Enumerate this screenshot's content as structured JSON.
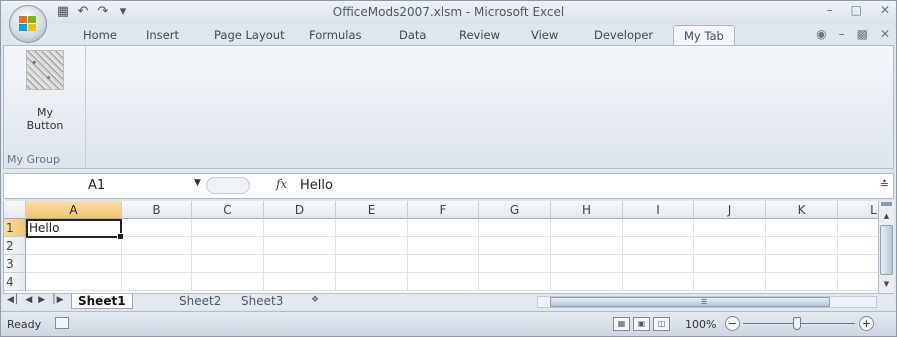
{
  "window": {
    "title": "OfficeMods2007.xlsm - Microsoft Excel",
    "qat_icons": [
      "save-icon",
      "undo-icon",
      "redo-icon",
      "customize-qat-icon"
    ]
  },
  "tabs": [
    {
      "label": "Home"
    },
    {
      "label": "Insert"
    },
    {
      "label": "Page Layout"
    },
    {
      "label": "Formulas"
    },
    {
      "label": "Data"
    },
    {
      "label": "Review"
    },
    {
      "label": "View"
    },
    {
      "label": "Developer"
    },
    {
      "label": "My Tab",
      "active": true
    }
  ],
  "ribbon": {
    "group_label": "My Group",
    "button_line1": "My",
    "button_line2": "Button"
  },
  "formula_bar": {
    "name_box": "A1",
    "fx_label": "fx",
    "value": "Hello"
  },
  "grid": {
    "columns": [
      "A",
      "B",
      "C",
      "D",
      "E",
      "F",
      "G",
      "H",
      "I",
      "J",
      "K",
      "L"
    ],
    "rows": [
      "1",
      "2",
      "3",
      "4"
    ],
    "cells": {
      "A1": "Hello"
    },
    "selected_cell": "A1"
  },
  "sheets": [
    {
      "label": "Sheet1",
      "active": true
    },
    {
      "label": "Sheet2"
    },
    {
      "label": "Sheet3"
    }
  ],
  "status": {
    "ready": "Ready",
    "zoom": "100%"
  },
  "colors": {
    "accent_selected_header": "#f1c56d",
    "chrome": "#dfe6ee"
  }
}
